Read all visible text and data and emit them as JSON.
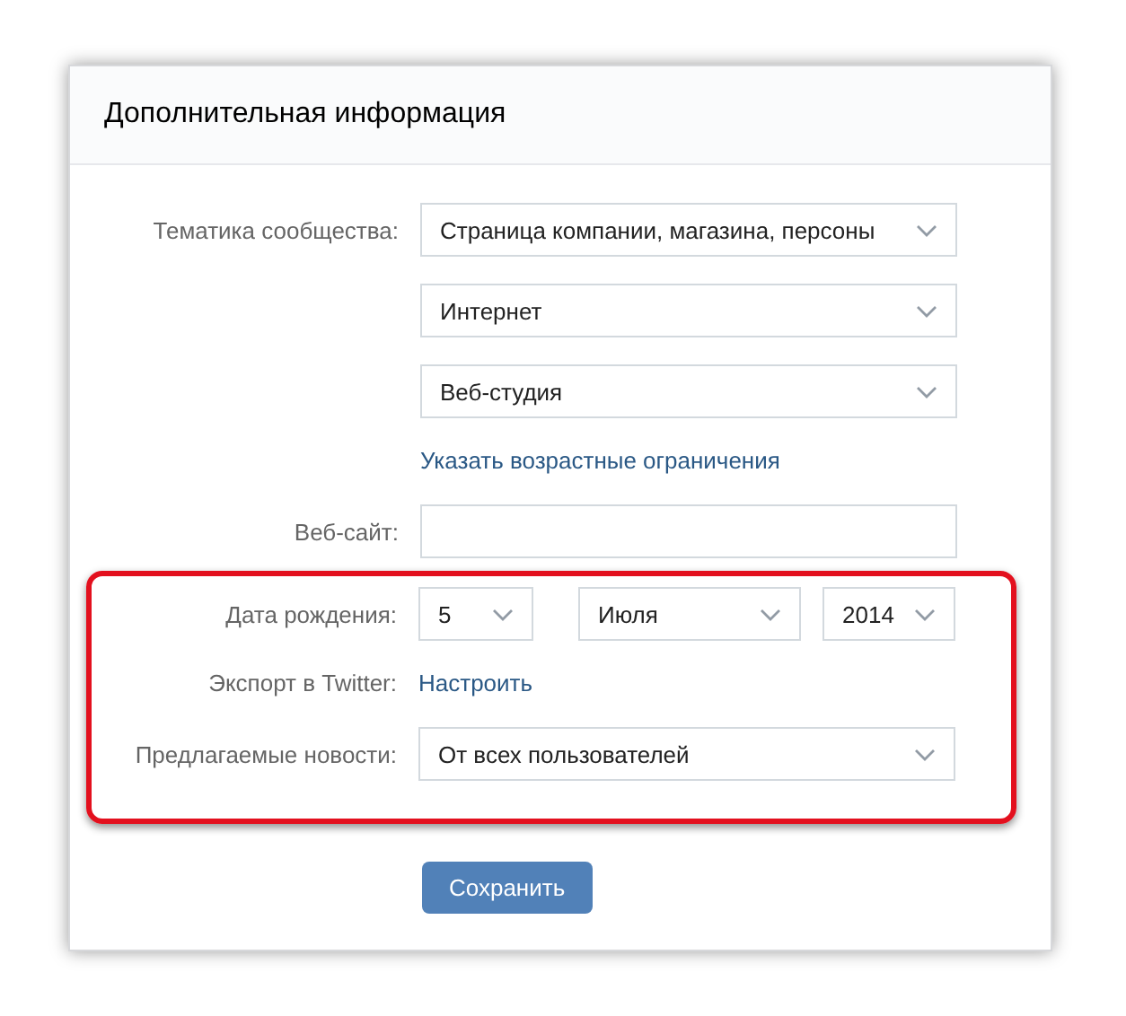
{
  "panel": {
    "title": "Дополнительная информация"
  },
  "sections": [
    {
      "highlighted": false,
      "rows": [
        {
          "kind": "select",
          "label": "Тематика сообщества:",
          "value": "Страница компании, магазина, персоны"
        },
        {
          "kind": "select",
          "value": "Интернет"
        },
        {
          "kind": "select",
          "value": "Веб-студия"
        },
        {
          "kind": "link",
          "value": "Указать возрастные ограничения"
        },
        {
          "kind": "input",
          "label": "Веб-сайт:"
        }
      ]
    },
    {
      "highlighted": true,
      "rows": [
        {
          "kind": "date",
          "label": "Дата рождения:",
          "parts": [
            "5",
            "Июля",
            "2014"
          ]
        },
        {
          "kind": "link",
          "label": "Экспорт в Twitter:",
          "value": "Настроить"
        },
        {
          "kind": "select",
          "label": "Предлагаемые новости:",
          "value": "От всех пользователей"
        }
      ]
    }
  ],
  "save_button": "Сохранить"
}
